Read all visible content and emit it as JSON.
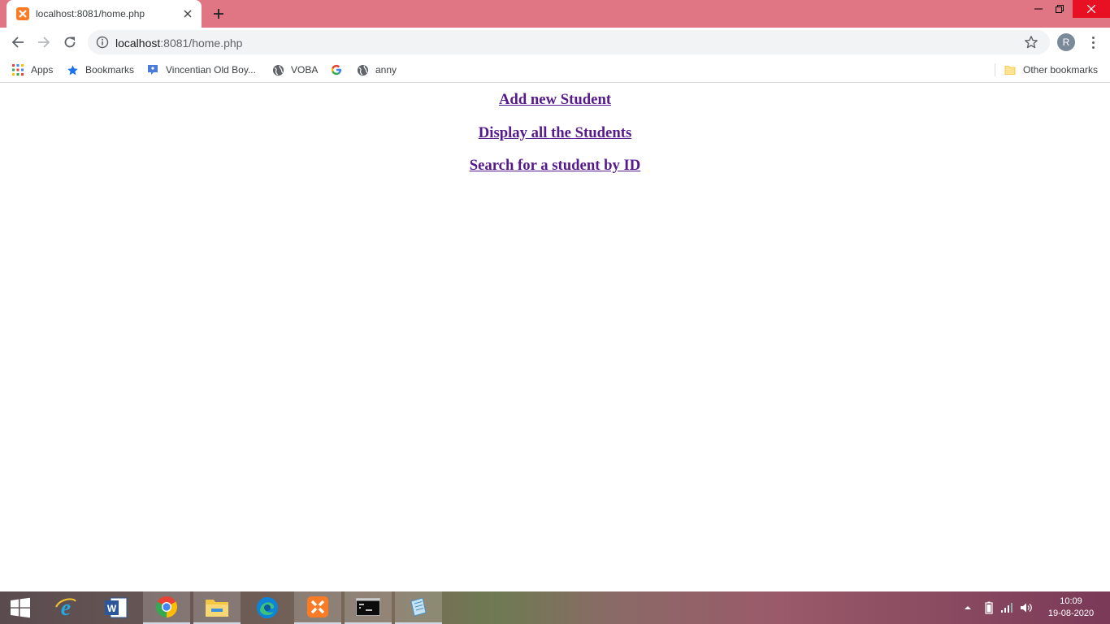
{
  "browser": {
    "tab_title": "localhost:8081/home.php",
    "url_host": "localhost",
    "url_rest": ":8081/home.php",
    "profile_initial": "R"
  },
  "bookmarks": {
    "apps": "Apps",
    "bookmarks": "Bookmarks",
    "vincentian": "Vincentian Old Boy...",
    "voba": "VOBA",
    "anny": "anny",
    "other": "Other bookmarks"
  },
  "page": {
    "links": [
      "Add new Student",
      "Display all the Students",
      "Search for a student by ID"
    ]
  },
  "taskbar": {
    "time": "10:09",
    "date": "19-08-2020"
  },
  "colors": {
    "tabstrip": "#e07583",
    "link_visited": "#551a8b",
    "close_hover": "#e81123"
  }
}
